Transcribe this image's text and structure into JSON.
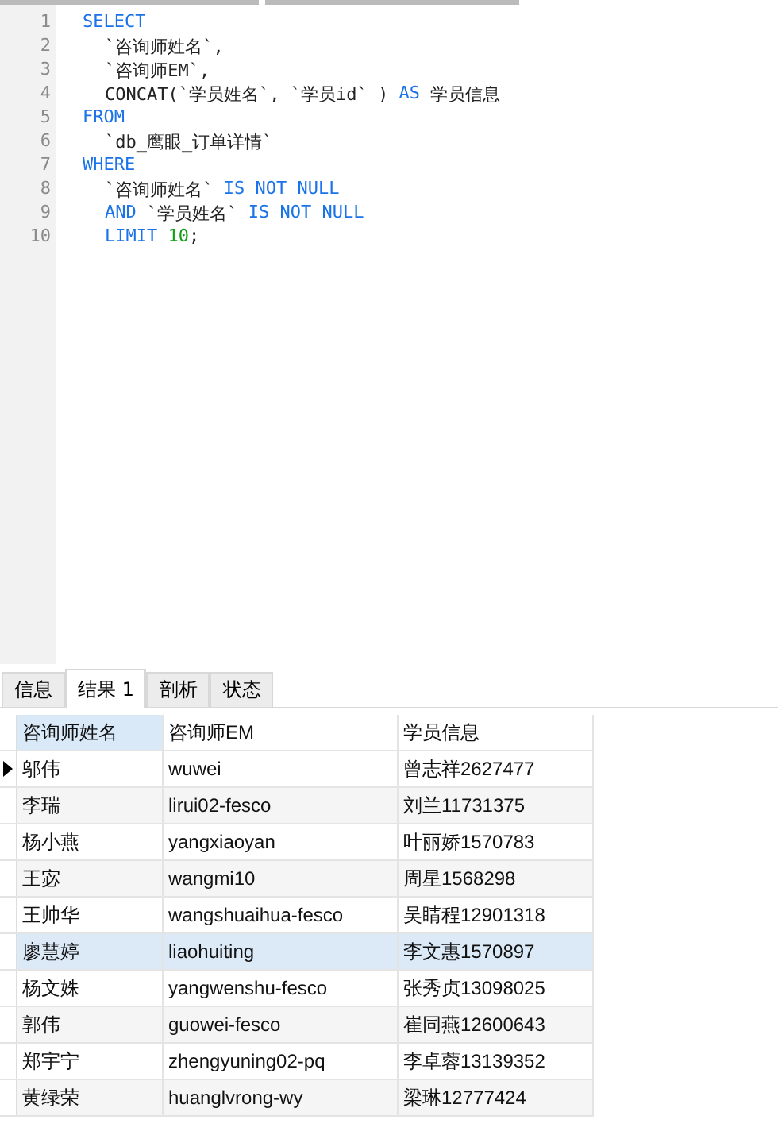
{
  "editor": {
    "lines": [
      {
        "number": "1",
        "segments": [
          {
            "kind": "keyword",
            "text": "SELECT"
          }
        ],
        "children": [
          {
            "number": "2",
            "segments": [
              {
                "kind": "plain",
                "text": "`咨询师姓名`,"
              }
            ]
          },
          {
            "number": "3",
            "segments": [
              {
                "kind": "plain",
                "text": "`咨询师EM`,"
              }
            ]
          },
          {
            "number": "4",
            "segments": [
              {
                "kind": "plain",
                "text": "CONCAT(`学员姓名`, `学员id` ) "
              },
              {
                "kind": "keyword",
                "text": "AS"
              },
              {
                "kind": "plain",
                "text": " 学员信息"
              }
            ]
          }
        ]
      },
      {
        "number": "5",
        "segments": [
          {
            "kind": "keyword",
            "text": "FROM"
          }
        ],
        "children": [
          {
            "number": "6",
            "segments": [
              {
                "kind": "plain",
                "text": "`db_鹰眼_订单详情`"
              }
            ]
          }
        ]
      },
      {
        "number": "7",
        "segments": [
          {
            "kind": "keyword",
            "text": "WHERE"
          }
        ],
        "children": [
          {
            "number": "8",
            "segments": [
              {
                "kind": "plain",
                "text": "`咨询师姓名` "
              },
              {
                "kind": "keyword",
                "text": "IS NOT NULL"
              }
            ]
          },
          {
            "number": "9",
            "segments": [
              {
                "kind": "keyword",
                "text": "AND"
              },
              {
                "kind": "plain",
                "text": " `学员姓名` "
              },
              {
                "kind": "keyword",
                "text": "IS NOT NULL"
              }
            ]
          },
          {
            "number": "10",
            "segments": [
              {
                "kind": "keyword",
                "text": "LIMIT "
              },
              {
                "kind": "number",
                "text": "10"
              },
              {
                "kind": "plain",
                "text": ";"
              }
            ]
          }
        ]
      }
    ]
  },
  "result_tabs": [
    {
      "label": "信息",
      "selected": false
    },
    {
      "label": "结果 1",
      "selected": true
    },
    {
      "label": "剖析",
      "selected": false
    },
    {
      "label": "状态",
      "selected": false
    }
  ],
  "table": {
    "columns": [
      {
        "label": "咨询师姓名",
        "selected": true
      },
      {
        "label": "咨询师EM",
        "selected": false
      },
      {
        "label": "学员信息",
        "selected": false
      }
    ],
    "rows": [
      {
        "selected": true,
        "highlighted": false,
        "cells": [
          "邬伟",
          "wuwei",
          "曾志祥2627477"
        ]
      },
      {
        "selected": false,
        "highlighted": false,
        "cells": [
          "李瑞",
          "lirui02-fesco",
          "刘兰11731375"
        ]
      },
      {
        "selected": false,
        "highlighted": false,
        "cells": [
          "杨小燕",
          "yangxiaoyan",
          "叶丽娇1570783"
        ]
      },
      {
        "selected": false,
        "highlighted": false,
        "cells": [
          "王宓",
          "wangmi10",
          "周星1568298"
        ]
      },
      {
        "selected": false,
        "highlighted": false,
        "cells": [
          "王帅华",
          "wangshuaihua-fesco",
          "吴睛程12901318"
        ]
      },
      {
        "selected": false,
        "highlighted": true,
        "cells": [
          "廖慧婷",
          "liaohuiting",
          "李文惠1570897"
        ]
      },
      {
        "selected": false,
        "highlighted": false,
        "cells": [
          "杨文姝",
          "yangwenshu-fesco",
          "张秀贞13098025"
        ]
      },
      {
        "selected": false,
        "highlighted": false,
        "cells": [
          "郭伟",
          "guowei-fesco",
          "崔同燕12600643"
        ]
      },
      {
        "selected": false,
        "highlighted": false,
        "cells": [
          "郑宇宁",
          "zhengyuning02-pq",
          "李卓蓉13139352"
        ]
      },
      {
        "selected": false,
        "highlighted": false,
        "cells": [
          "黄绿荣",
          "huanglvrong-wy",
          "梁琳12777424"
        ]
      }
    ]
  }
}
